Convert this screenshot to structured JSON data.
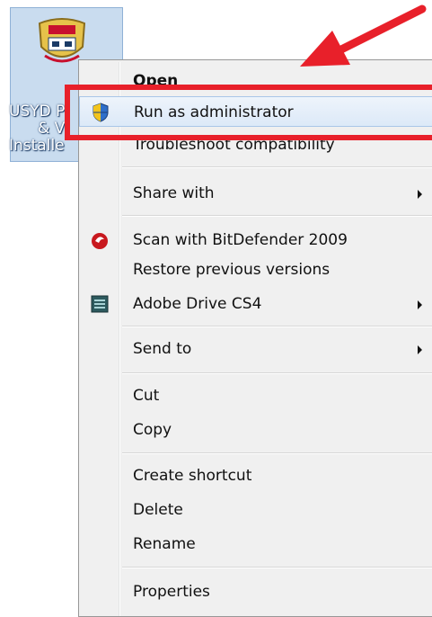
{
  "desktop_icon": {
    "label_lines": [
      "USYD P",
      "& V",
      "Installe"
    ]
  },
  "context_menu": {
    "items": [
      {
        "label": "Open",
        "bold": true
      },
      {
        "label": "Run as administrator",
        "icon": "shield-uac-icon",
        "highlighted": true
      },
      {
        "label": "Troubleshoot compatibility"
      },
      {
        "label": "Share with",
        "submenu": true
      },
      {
        "label": "Scan with BitDefender 2009",
        "icon": "bitdefender-icon"
      },
      {
        "label": "Restore previous versions"
      },
      {
        "label": "Adobe Drive CS4",
        "icon": "adobe-drive-icon",
        "submenu": true
      },
      {
        "label": "Send to",
        "submenu": true
      },
      {
        "label": "Cut"
      },
      {
        "label": "Copy"
      },
      {
        "label": "Create shortcut"
      },
      {
        "label": "Delete"
      },
      {
        "label": "Rename"
      },
      {
        "label": "Properties"
      }
    ]
  },
  "annotation": {
    "highlight_color": "#e8202a"
  }
}
